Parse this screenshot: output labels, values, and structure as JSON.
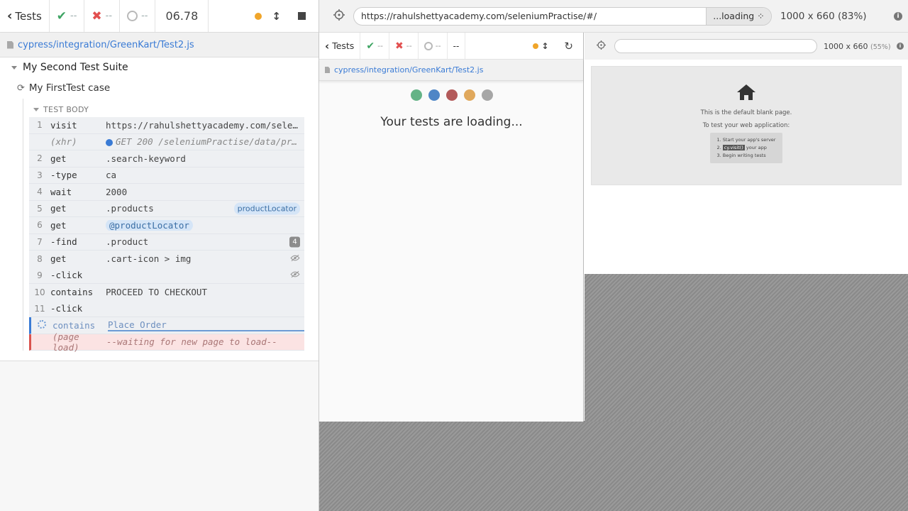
{
  "reporter": {
    "back_label": "Tests",
    "passed": "--",
    "failed": "--",
    "pending": "--",
    "duration": "06.78",
    "spec_path": "cypress/integration/GreenKart/Test2.js",
    "suite_title": "My Second Test Suite",
    "test_title": "My FirstTest case",
    "body_label": "TEST BODY",
    "commands": [
      {
        "num": "1",
        "name": "visit",
        "msg": "https://rahulshettyacademy.com/seleniumPractise/#/"
      },
      {
        "num": "",
        "name": "(xhr)",
        "msg": "GET 200 /seleniumPractise/data/products.json"
      },
      {
        "num": "2",
        "name": "get",
        "msg": ".search-keyword"
      },
      {
        "num": "3",
        "name": "-type",
        "msg": "ca"
      },
      {
        "num": "4",
        "name": "wait",
        "msg": "2000"
      },
      {
        "num": "5",
        "name": "get",
        "msg": ".products",
        "alias": "productLocator"
      },
      {
        "num": "6",
        "name": "get",
        "msg": "@productLocator"
      },
      {
        "num": "7",
        "name": "-find",
        "msg": ".product",
        "count": "4"
      },
      {
        "num": "8",
        "name": "get",
        "msg": ".cart-icon > img"
      },
      {
        "num": "9",
        "name": "-click",
        "msg": ""
      },
      {
        "num": "10",
        "name": "contains",
        "msg": "PROCEED TO CHECKOUT"
      },
      {
        "num": "11",
        "name": "-click",
        "msg": ""
      },
      {
        "num": "",
        "name": "contains",
        "msg": "Place Order"
      },
      {
        "num": "",
        "name": "(page load)",
        "msg": "--waiting for new page to load--"
      }
    ]
  },
  "aut": {
    "url": "https://rahulshettyacademy.com/seleniumPractise/#/",
    "loading_label": "...loading",
    "viewport": "1000 x 660",
    "scale": "(83%)"
  },
  "inner_reporter": {
    "back_label": "Tests",
    "passed": "--",
    "failed": "--",
    "pending": "--",
    "duration": "--",
    "spec_path": "cypress/integration/GreenKart/Test2.js",
    "loading_message": "Your tests are loading...",
    "dot_colors": [
      "#64b386",
      "#4f86c6",
      "#b35a5a",
      "#e0a85c",
      "#a6a6a6"
    ]
  },
  "inner_aut": {
    "viewport": "1000 x 660",
    "scale": "(55%)",
    "blank_title": "This is the default blank page.",
    "blank_subtitle": "To test your web application:",
    "step1": "1. Start your app's server",
    "step2_prefix": "2.",
    "step2_code": "cy.visit()",
    "step2_suffix": "your app",
    "step3": "3. Begin writing tests"
  },
  "colors": {
    "passed": "#3ea463",
    "failed": "#e24f4f",
    "link": "#3a7bd5",
    "running": "#f0a52a"
  }
}
